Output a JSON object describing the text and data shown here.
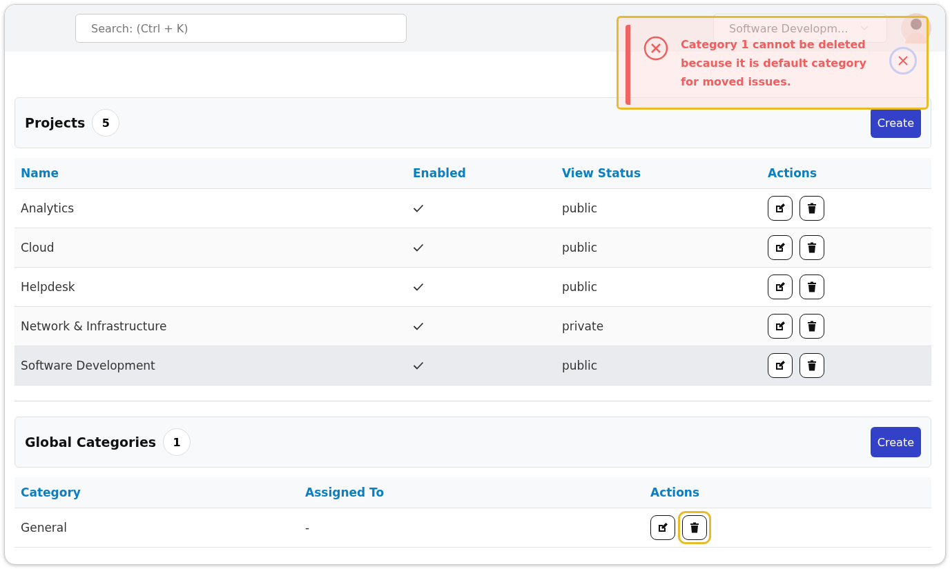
{
  "header": {
    "search": {
      "placeholder": "Search: (Ctrl + K)"
    },
    "project_select": {
      "value": "Software Developm..."
    }
  },
  "toast": {
    "kind": "error",
    "message": "Category 1 cannot be deleted because it is default category for moved issues.",
    "highlighted": true
  },
  "projects": {
    "title": "Projects",
    "count": "5",
    "create_button": "Create",
    "columns": [
      "Name",
      "Enabled",
      "View Status",
      "Actions"
    ],
    "rows": [
      {
        "name": "Analytics",
        "enabled": true,
        "view_status": "public",
        "selected": false
      },
      {
        "name": "Cloud",
        "enabled": true,
        "view_status": "public",
        "selected": false
      },
      {
        "name": "Helpdesk",
        "enabled": true,
        "view_status": "public",
        "selected": false
      },
      {
        "name": "Network & Infrastructure",
        "enabled": true,
        "view_status": "private",
        "selected": false
      },
      {
        "name": "Software Development",
        "enabled": true,
        "view_status": "public",
        "selected": true
      }
    ]
  },
  "categories": {
    "title": "Global Categories",
    "count": "1",
    "create_button": "Create",
    "columns": [
      "Category",
      "Assigned To",
      "Actions"
    ],
    "rows": [
      {
        "category": "General",
        "assigned_to": "-",
        "delete_highlighted": true
      }
    ]
  }
}
